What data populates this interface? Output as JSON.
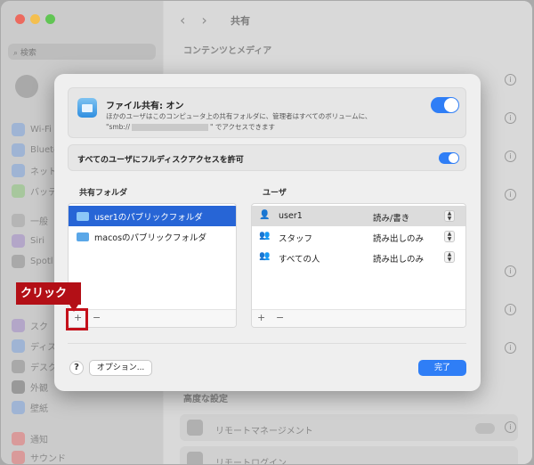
{
  "window": {
    "title": "共有"
  },
  "sidebar": {
    "search_placeholder": "検索",
    "items": [
      {
        "label": "Wi-Fi",
        "icon": "wifi-icon"
      },
      {
        "label": "Blueto",
        "icon": "bluetooth-icon"
      },
      {
        "label": "ネット",
        "icon": "network-icon"
      },
      {
        "label": "バッテ",
        "icon": "battery-icon"
      },
      {
        "label": "一般",
        "icon": "gear-icon"
      },
      {
        "label": "Siri",
        "icon": "siri-icon"
      },
      {
        "label": "Spotl",
        "icon": "spotlight-icon"
      },
      {
        "label": "スク",
        "icon": "screentime-icon"
      },
      {
        "label": "ディス",
        "icon": "display-icon"
      },
      {
        "label": "デスク",
        "icon": "desktop-icon"
      },
      {
        "label": "外観",
        "icon": "appearance-icon"
      },
      {
        "label": "壁紙",
        "icon": "wallpaper-icon"
      },
      {
        "label": "通知",
        "icon": "notification-icon"
      },
      {
        "label": "サウンド",
        "icon": "sound-icon"
      }
    ]
  },
  "main": {
    "section_content_media": "コンテンツとメディア",
    "section_advanced": "高度な設定",
    "row_remote_management": "リモートマネージメント",
    "row_remote_login": "リモートログイン"
  },
  "dialog": {
    "file_sharing_title": "ファイル共有: オン",
    "file_sharing_desc1": "ほかのユーザはこのコンピュータ上の共有フォルダに、管理者はすべてのボリュームに、",
    "file_sharing_desc2_pre": "\"smb://",
    "file_sharing_desc2_post": "\" でアクセスできます",
    "full_disk_label": "すべてのユーザにフルディスクアクセスを許可",
    "shared_folders_label": "共有フォルダ",
    "users_label": "ユーザ",
    "folders": [
      {
        "name": "user1のパブリックフォルダ",
        "selected": true
      },
      {
        "name": "macosのパブリックフォルダ",
        "selected": false
      }
    ],
    "users": [
      {
        "name": "user1",
        "permission": "読み/書き",
        "icon": "person-icon"
      },
      {
        "name": "スタッフ",
        "permission": "読み出しのみ",
        "icon": "group-icon"
      },
      {
        "name": "すべての人",
        "permission": "読み出しのみ",
        "icon": "everyone-icon"
      }
    ],
    "add_symbol": "+",
    "remove_symbol": "−",
    "help_label": "?",
    "options_label": "オプション...",
    "done_label": "完了",
    "file_sharing_on": true,
    "full_disk_on": true
  },
  "annotation": {
    "label": "クリック",
    "color": "#b30f16"
  }
}
